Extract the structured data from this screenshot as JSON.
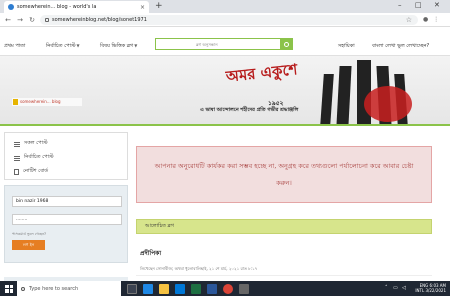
{
  "browser": {
    "tab_title": "somewherein... blog - world's la",
    "tab_close": "×",
    "new_tab": "+",
    "url": "somewhereinblog.net/blog/sonet1971",
    "win_min": "–",
    "win_max": "□",
    "win_close": "✕"
  },
  "sitenav": {
    "items": [
      "প্রথম পাতা",
      "নির্বাচিত পোস্ট",
      "বিষয় ভিত্তিক ব্লগ",
      "সহায়িকা",
      "বাংলা লেখা ভুল লেখাচ্ছেন?"
    ],
    "search_placeholder": "ব্লগ অনুসন্ধান"
  },
  "banner": {
    "logo_text": "somewherein... blog",
    "headline": "অমর একুশে",
    "year": "১৯৫২",
    "tagline": "এ ভাষা আন্দোলনে শহীদের প্রতি গভীর শ্রদ্ধাঞ্জলি"
  },
  "sidebar": {
    "items": [
      "সকল পোস্ট",
      "নির্বাচিত পোস্ট",
      "নোটিশ বোর্ড"
    ],
    "username": "bin nazir 1968",
    "password_mask": "........",
    "forgot": "পাসওয়ার্ড ভুলে গেছেন?",
    "login_button": "লগ ইন"
  },
  "main": {
    "alert": "আপনার অনুরোধটি কার্যকর করা সম্ভব হচ্ছে না, অনুগ্রহ করে তথ্যগুলো পর্যালোচনা করে আবার চেষ্টা করুন।",
    "discussed_heading": "আলোচিত ব্লগ",
    "post_title": "প্রদীপিকা",
    "post_meta": "লিখেছেন সোনাবীজ; অথবা ধুলোবালিছাই, ২১ শে মার্চ, ২০২১ রাত ৮:১৭"
  },
  "taskbar": {
    "search_placeholder": "Type here to search",
    "lang": "ENG",
    "lang_sub": "INTL",
    "time": "6:03 AM",
    "date": "3/22/2021"
  }
}
